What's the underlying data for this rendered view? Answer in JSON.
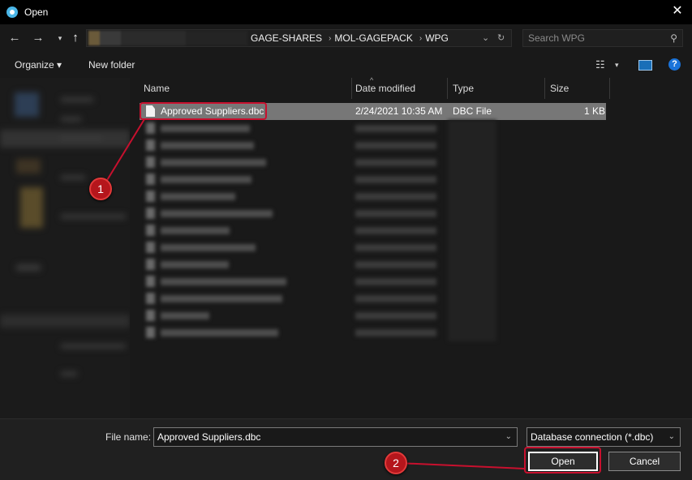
{
  "window": {
    "title": "Open"
  },
  "address": {
    "crumbs": [
      "GAGE-SHARES",
      "MOL-GAGEPACK",
      "WPG"
    ]
  },
  "search": {
    "placeholder": "Search WPG"
  },
  "toolbar": {
    "organize": "Organize ▾",
    "new_folder": "New folder"
  },
  "columns": {
    "name": "Name",
    "date_modified": "Date modified",
    "type": "Type",
    "size": "Size"
  },
  "selected_file": {
    "name": "Approved Suppliers.dbc",
    "date": "2/24/2021 10:35 AM",
    "type": "DBC File",
    "size": "1 KB"
  },
  "footer": {
    "file_name_label": "File name:",
    "file_name_value": "Approved Suppliers.dbc",
    "filter": "Database connection (*.dbc)",
    "open_label": "Open",
    "cancel_label": "Cancel"
  },
  "annotations": {
    "step1": "1",
    "step2": "2",
    "color": "#c8102e"
  }
}
